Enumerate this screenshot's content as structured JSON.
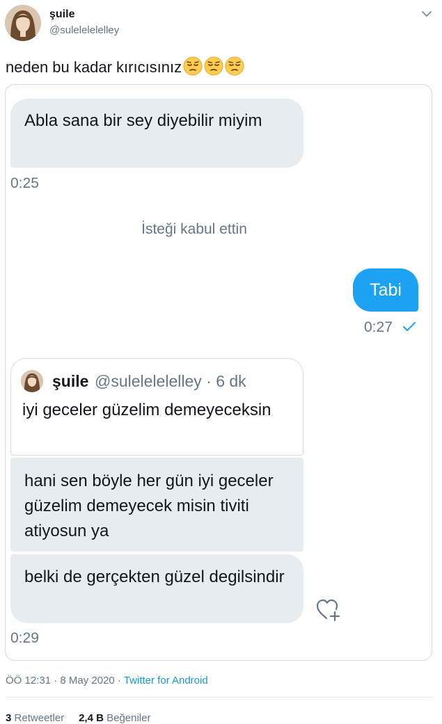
{
  "author": {
    "display_name": "şuile",
    "handle": "@sulelelelelley"
  },
  "tweet": {
    "text": "neden bu kadar kırıcısınız",
    "emojis": [
      "pensive-face",
      "pensive-face",
      "pensive-face"
    ]
  },
  "conversation": {
    "msg1": "Abla sana bir sey diyebilir miyim",
    "time1": "0:25",
    "system_message": "İsteği kabul ettin",
    "msg2": "Tabi",
    "time2": "0:27",
    "quoted_tweet": {
      "name": "şuile",
      "handle_time": "@sulelelelelley · 6 dk",
      "text": "iyi geceler güzelim demeyeceksin"
    },
    "msg3": "hani sen böyle her gün iyi geceler güzelim demeyecek misin tiviti atiyosun ya",
    "msg4": "belki de gerçekten güzel degilsindir",
    "time3": "0:29"
  },
  "meta": {
    "timestamp": "ÖÖ 12:31 · 8 May 2020 · ",
    "source": "Twitter for Android"
  },
  "stats": {
    "retweets_count": "3",
    "retweets_label": "Retweetler",
    "likes_count": "2,4 B",
    "likes_label": "Beğeniler"
  },
  "colors": {
    "accent": "#1da1f2",
    "incoming_bubble": "#e6ecf0",
    "secondary_text": "#657786"
  }
}
